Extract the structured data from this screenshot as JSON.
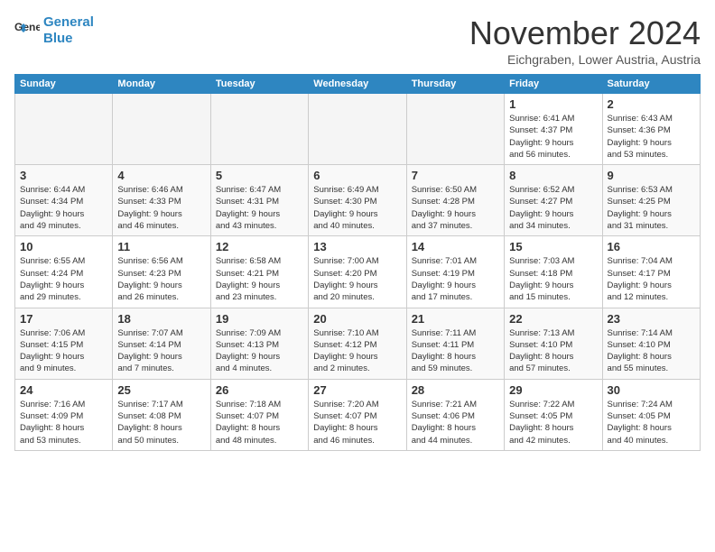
{
  "header": {
    "logo_line1": "General",
    "logo_line2": "Blue",
    "month": "November 2024",
    "location": "Eichgraben, Lower Austria, Austria"
  },
  "weekdays": [
    "Sunday",
    "Monday",
    "Tuesday",
    "Wednesday",
    "Thursday",
    "Friday",
    "Saturday"
  ],
  "weeks": [
    [
      {
        "day": "",
        "info": ""
      },
      {
        "day": "",
        "info": ""
      },
      {
        "day": "",
        "info": ""
      },
      {
        "day": "",
        "info": ""
      },
      {
        "day": "",
        "info": ""
      },
      {
        "day": "1",
        "info": "Sunrise: 6:41 AM\nSunset: 4:37 PM\nDaylight: 9 hours\nand 56 minutes."
      },
      {
        "day": "2",
        "info": "Sunrise: 6:43 AM\nSunset: 4:36 PM\nDaylight: 9 hours\nand 53 minutes."
      }
    ],
    [
      {
        "day": "3",
        "info": "Sunrise: 6:44 AM\nSunset: 4:34 PM\nDaylight: 9 hours\nand 49 minutes."
      },
      {
        "day": "4",
        "info": "Sunrise: 6:46 AM\nSunset: 4:33 PM\nDaylight: 9 hours\nand 46 minutes."
      },
      {
        "day": "5",
        "info": "Sunrise: 6:47 AM\nSunset: 4:31 PM\nDaylight: 9 hours\nand 43 minutes."
      },
      {
        "day": "6",
        "info": "Sunrise: 6:49 AM\nSunset: 4:30 PM\nDaylight: 9 hours\nand 40 minutes."
      },
      {
        "day": "7",
        "info": "Sunrise: 6:50 AM\nSunset: 4:28 PM\nDaylight: 9 hours\nand 37 minutes."
      },
      {
        "day": "8",
        "info": "Sunrise: 6:52 AM\nSunset: 4:27 PM\nDaylight: 9 hours\nand 34 minutes."
      },
      {
        "day": "9",
        "info": "Sunrise: 6:53 AM\nSunset: 4:25 PM\nDaylight: 9 hours\nand 31 minutes."
      }
    ],
    [
      {
        "day": "10",
        "info": "Sunrise: 6:55 AM\nSunset: 4:24 PM\nDaylight: 9 hours\nand 29 minutes."
      },
      {
        "day": "11",
        "info": "Sunrise: 6:56 AM\nSunset: 4:23 PM\nDaylight: 9 hours\nand 26 minutes."
      },
      {
        "day": "12",
        "info": "Sunrise: 6:58 AM\nSunset: 4:21 PM\nDaylight: 9 hours\nand 23 minutes."
      },
      {
        "day": "13",
        "info": "Sunrise: 7:00 AM\nSunset: 4:20 PM\nDaylight: 9 hours\nand 20 minutes."
      },
      {
        "day": "14",
        "info": "Sunrise: 7:01 AM\nSunset: 4:19 PM\nDaylight: 9 hours\nand 17 minutes."
      },
      {
        "day": "15",
        "info": "Sunrise: 7:03 AM\nSunset: 4:18 PM\nDaylight: 9 hours\nand 15 minutes."
      },
      {
        "day": "16",
        "info": "Sunrise: 7:04 AM\nSunset: 4:17 PM\nDaylight: 9 hours\nand 12 minutes."
      }
    ],
    [
      {
        "day": "17",
        "info": "Sunrise: 7:06 AM\nSunset: 4:15 PM\nDaylight: 9 hours\nand 9 minutes."
      },
      {
        "day": "18",
        "info": "Sunrise: 7:07 AM\nSunset: 4:14 PM\nDaylight: 9 hours\nand 7 minutes."
      },
      {
        "day": "19",
        "info": "Sunrise: 7:09 AM\nSunset: 4:13 PM\nDaylight: 9 hours\nand 4 minutes."
      },
      {
        "day": "20",
        "info": "Sunrise: 7:10 AM\nSunset: 4:12 PM\nDaylight: 9 hours\nand 2 minutes."
      },
      {
        "day": "21",
        "info": "Sunrise: 7:11 AM\nSunset: 4:11 PM\nDaylight: 8 hours\nand 59 minutes."
      },
      {
        "day": "22",
        "info": "Sunrise: 7:13 AM\nSunset: 4:10 PM\nDaylight: 8 hours\nand 57 minutes."
      },
      {
        "day": "23",
        "info": "Sunrise: 7:14 AM\nSunset: 4:10 PM\nDaylight: 8 hours\nand 55 minutes."
      }
    ],
    [
      {
        "day": "24",
        "info": "Sunrise: 7:16 AM\nSunset: 4:09 PM\nDaylight: 8 hours\nand 53 minutes."
      },
      {
        "day": "25",
        "info": "Sunrise: 7:17 AM\nSunset: 4:08 PM\nDaylight: 8 hours\nand 50 minutes."
      },
      {
        "day": "26",
        "info": "Sunrise: 7:18 AM\nSunset: 4:07 PM\nDaylight: 8 hours\nand 48 minutes."
      },
      {
        "day": "27",
        "info": "Sunrise: 7:20 AM\nSunset: 4:07 PM\nDaylight: 8 hours\nand 46 minutes."
      },
      {
        "day": "28",
        "info": "Sunrise: 7:21 AM\nSunset: 4:06 PM\nDaylight: 8 hours\nand 44 minutes."
      },
      {
        "day": "29",
        "info": "Sunrise: 7:22 AM\nSunset: 4:05 PM\nDaylight: 8 hours\nand 42 minutes."
      },
      {
        "day": "30",
        "info": "Sunrise: 7:24 AM\nSunset: 4:05 PM\nDaylight: 8 hours\nand 40 minutes."
      }
    ]
  ]
}
